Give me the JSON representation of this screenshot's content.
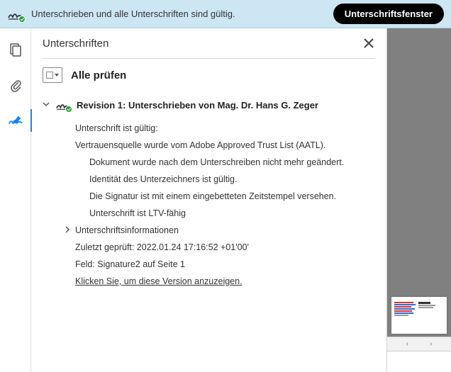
{
  "banner": {
    "message": "Unterschrieben und alle Unterschriften sind gültig.",
    "button": "Unterschriftsfenster"
  },
  "panel": {
    "title": "Unterschriften",
    "check_all": "Alle prüfen"
  },
  "revision": {
    "title": "Revision 1: Unterschrieben von Mag. Dr. Hans G. Zeger",
    "lines": {
      "valid": "Unterschrift ist gültig:",
      "trust": "Vertrauensquelle wurde vom Adobe Approved Trust List (AATL).",
      "unchanged": "Dokument wurde nach dem Unterschreiben nicht mehr geändert.",
      "identity": "Identität des Unterzeichners ist gültig.",
      "timestamp": "Die Signatur ist mit einem eingebetteten Zeitstempel versehen.",
      "ltv": "Unterschrift ist LTV-fähig"
    },
    "info_label": "Unterschriftsinformationen",
    "last_checked": "Zuletzt geprüft: 2022.01.24 17:16:52 +01'00'",
    "field": "Feld: Signature2 auf Seite 1",
    "view_version": "Klicken Sie, um diese Version anzuzeigen."
  },
  "icons": {
    "signature": "signature-icon",
    "pages": "pages-icon",
    "attachment": "attachment-icon",
    "pen": "pen-icon",
    "close": "close-icon",
    "chevron_down": "chevron-down-icon",
    "chevron_right": "chevron-right-icon"
  }
}
